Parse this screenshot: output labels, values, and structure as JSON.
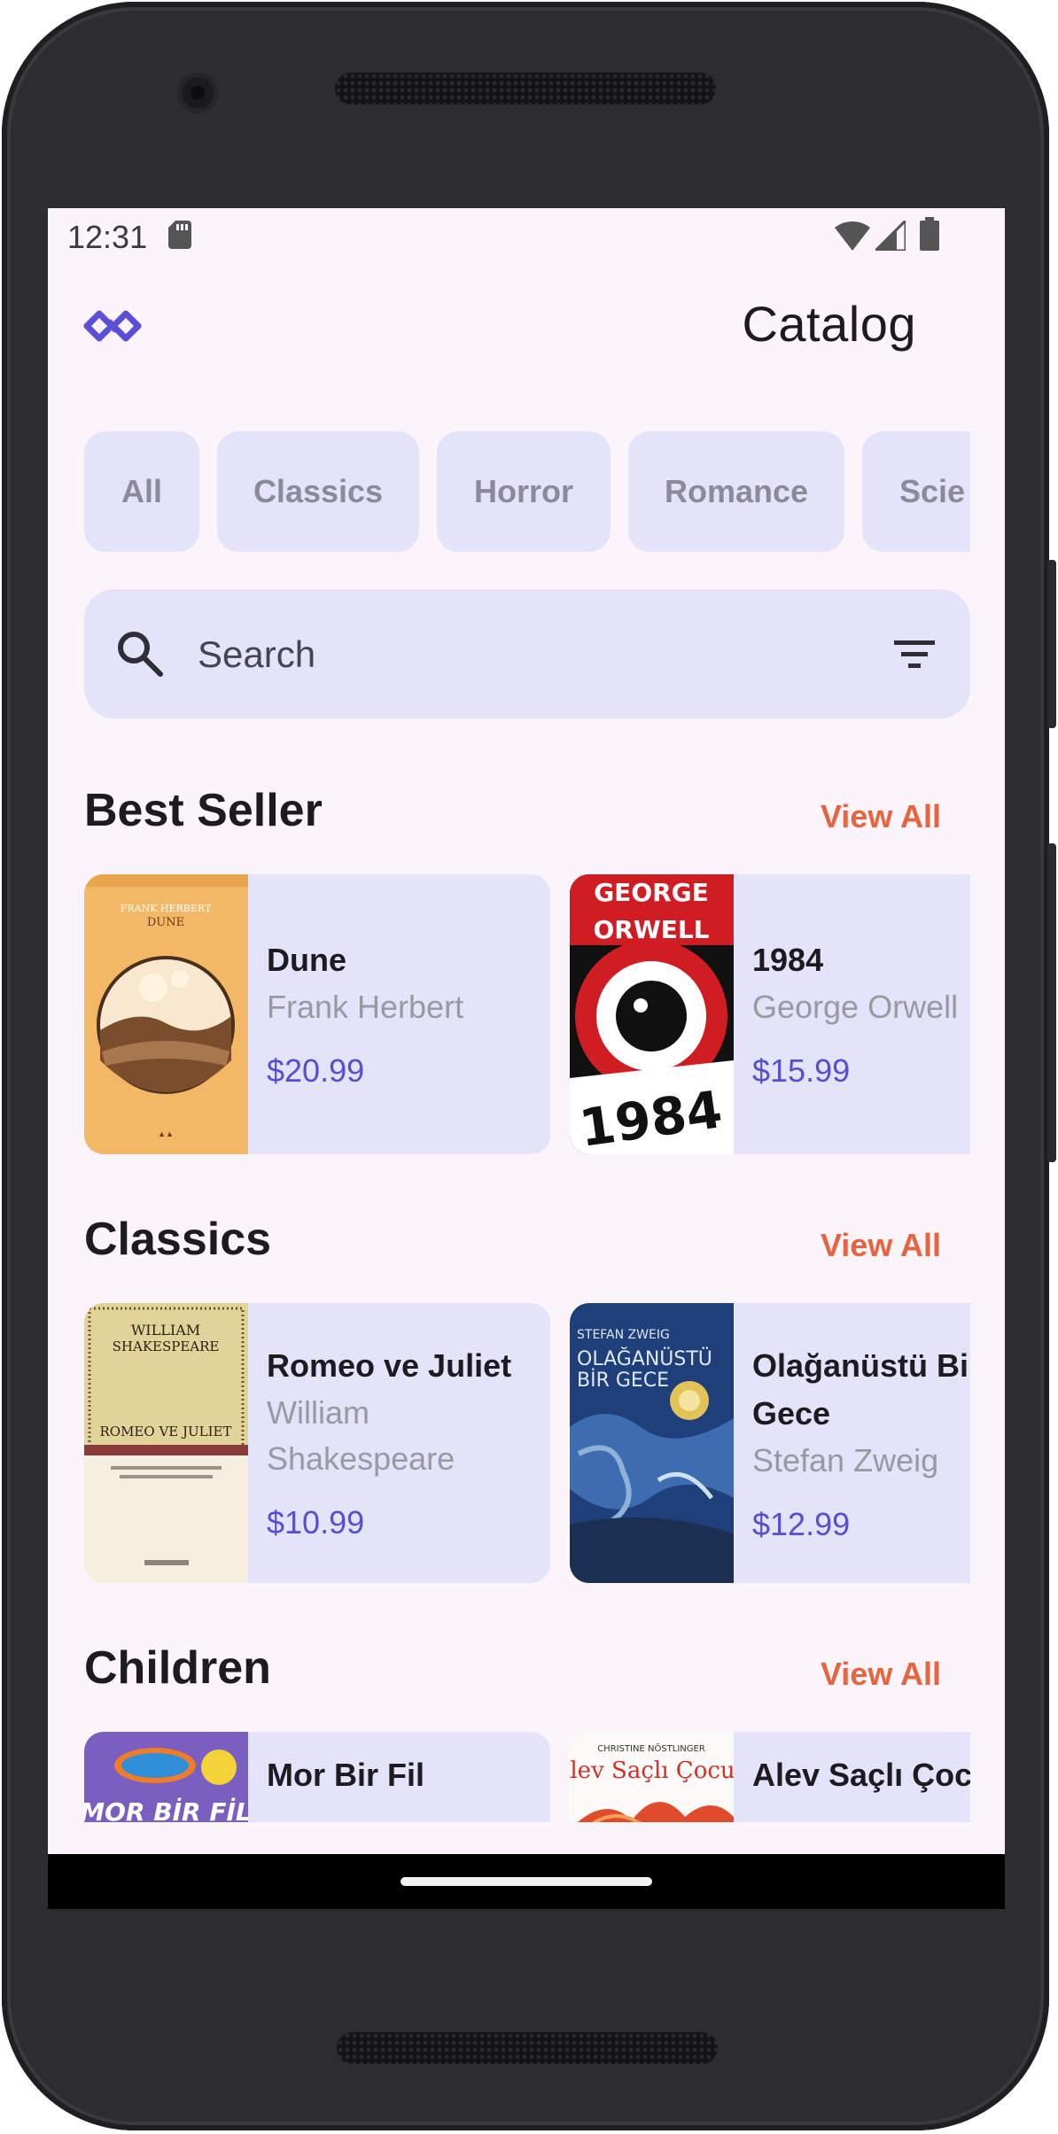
{
  "status_bar": {
    "time": "12:31"
  },
  "header": {
    "title": "Catalog"
  },
  "categories": [
    "All",
    "Classics",
    "Horror",
    "Romance",
    "Scie"
  ],
  "search": {
    "placeholder": "Search"
  },
  "sections": [
    {
      "title": "Best Seller",
      "view_all": "View All",
      "books": [
        {
          "title": "Dune",
          "author": "Frank Herbert",
          "price": "$20.99",
          "cover": {
            "top_text": "FRANK HERBERT",
            "title_text": "DUNE"
          }
        },
        {
          "title": "1984",
          "author": "George Orwell",
          "price": "$15.99",
          "cover": {
            "top_text": "GEORGE",
            "title_text": "ORWELL",
            "year_text": "1984"
          }
        }
      ]
    },
    {
      "title": "Classics",
      "view_all": "View All",
      "books": [
        {
          "title": "Romeo ve Juliet",
          "author": "William Shakespeare",
          "price": "$10.99",
          "cover": {
            "top_text": "WILLIAM",
            "top_text_2": "SHAKESPEARE",
            "title_text": "ROMEO VE JULIET"
          }
        },
        {
          "title": "Olağanüstü Bir Gece",
          "author": "Stefan Zweig",
          "price": "$12.99",
          "cover": {
            "top_text": "STEFAN ZWEIG",
            "title_text": "OLAĞANÜSTÜ",
            "title_text_2": "BİR GECE"
          }
        }
      ]
    },
    {
      "title": "Children",
      "view_all": "View All",
      "books": [
        {
          "title": "Mor Bir Fil",
          "cover": {
            "title_text": "MOR BİR FİL"
          }
        },
        {
          "title": "Alev Saçlı Çocuk",
          "cover": {
            "top_text": "CHRISTINE NÖSTLINGER",
            "title_text": "Alev Saçlı Çocuk"
          }
        }
      ]
    }
  ]
}
